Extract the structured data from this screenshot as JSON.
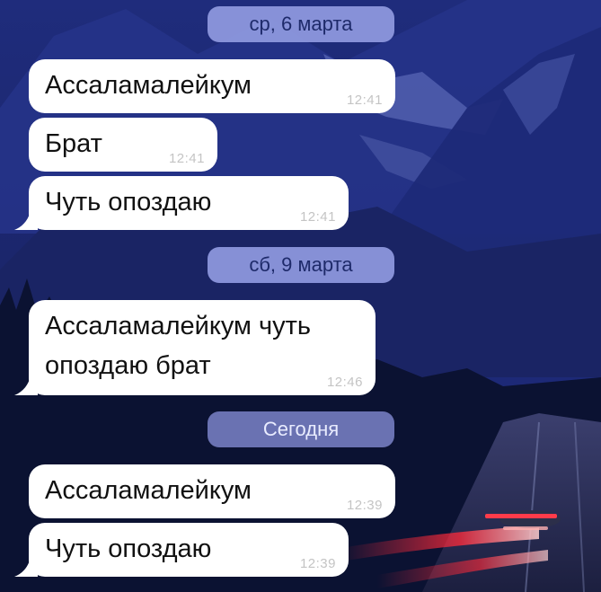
{
  "chat": {
    "background_colors": {
      "sky": "#1b2671",
      "mountain": "#243386",
      "forest": "#0b1232",
      "road": "#2a2f5c",
      "bubble": "#ffffff",
      "date_chip": "#929ce2",
      "tail_light": "#ff2a3a"
    },
    "groups": [
      {
        "date": "ср, 6 марта",
        "messages": [
          {
            "text": "Ассаламалейкум",
            "time": "12:41"
          },
          {
            "text": "Брат",
            "time": "12:41"
          },
          {
            "text": "Чуть опоздаю",
            "time": "12:41"
          }
        ]
      },
      {
        "date": "сб, 9 марта",
        "messages": [
          {
            "text_line1": "Ассаламалейкум чуть",
            "text_line2": "опоздаю брат",
            "time": "12:46"
          }
        ]
      },
      {
        "date": "Сегодня",
        "messages": [
          {
            "text": "Ассаламалейкум",
            "time": "12:39"
          },
          {
            "text": "Чуть опоздаю",
            "time": "12:39"
          }
        ]
      }
    ]
  }
}
